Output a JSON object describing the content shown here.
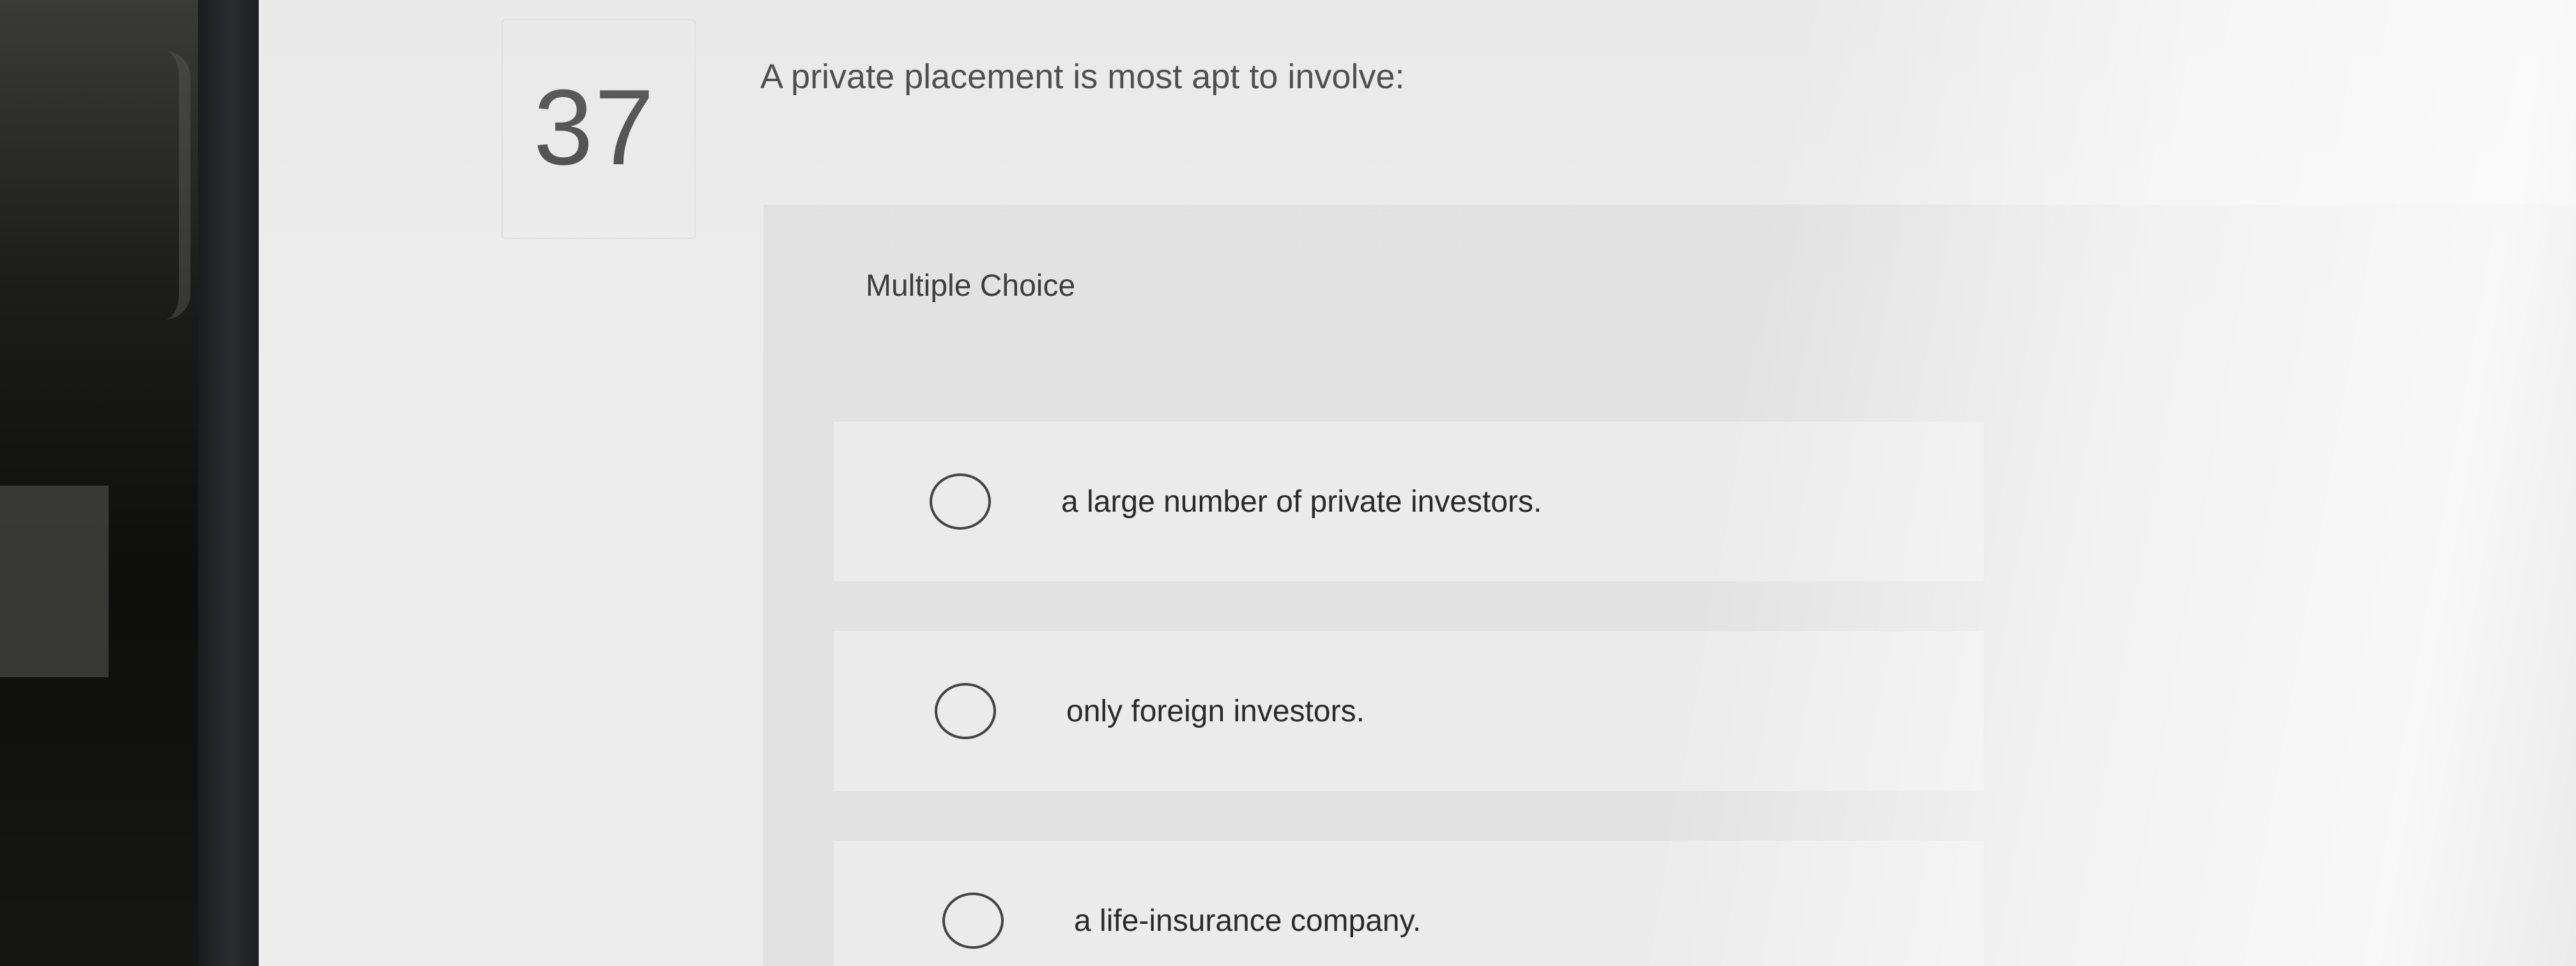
{
  "question": {
    "number": "37",
    "text": "A private placement is most apt to involve:"
  },
  "answer_area": {
    "type_label": "Multiple Choice",
    "options": [
      {
        "label": "a large number of private investors.",
        "selected": false
      },
      {
        "label": "only foreign investors.",
        "selected": false
      },
      {
        "label": "a life-insurance company.",
        "selected": false
      }
    ]
  },
  "colors": {
    "page_background": "#ededed",
    "panel_background": "#e2e2e2",
    "text": "#2c2c2c",
    "radio_border": "#444444"
  }
}
